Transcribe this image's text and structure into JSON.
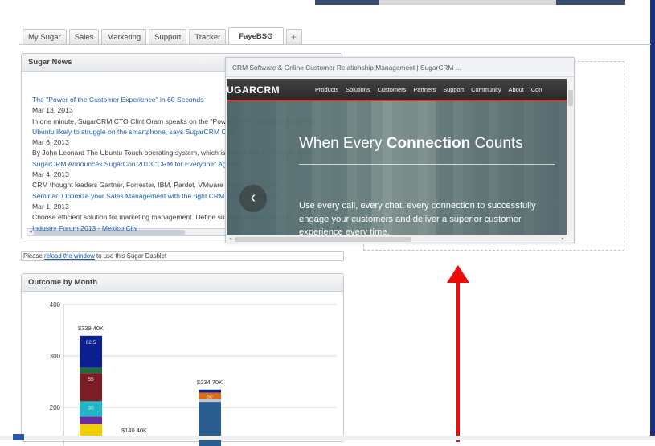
{
  "tabs": [
    {
      "label": "My Sugar",
      "active": false
    },
    {
      "label": "Sales",
      "active": false
    },
    {
      "label": "Marketing",
      "active": false
    },
    {
      "label": "Support",
      "active": false
    },
    {
      "label": "Tracker",
      "active": false
    },
    {
      "label": "FayeBSG",
      "active": true
    },
    {
      "label": "+",
      "active": false
    }
  ],
  "sugar_news": {
    "title": "Sugar News",
    "items": [
      {
        "text": "The \"Power of the Customer Experience\" in 60 Seconds",
        "kind": "link"
      },
      {
        "text": "Mar 13, 2013",
        "kind": "text"
      },
      {
        "text": "In one minute, SugarCRM CTO Clint Oram speaks on the \"Power of the Customer Experienc",
        "kind": "text"
      },
      {
        "text": "Ubuntu likely to struggle on the smartphone, says SugarCRM CEO",
        "kind": "link"
      },
      {
        "text": "Mar 6, 2013",
        "kind": "text"
      },
      {
        "text": "By John Leonard The Ubuntu Touch operating system, which is scheduled for October relea",
        "kind": "text"
      },
      {
        "text": "SugarCRM Announces SugarCon 2013 \"CRM for Everyone\" Agenda",
        "kind": "link"
      },
      {
        "text": "Mar 4, 2013",
        "kind": "text"
      },
      {
        "text": "CRM thought leaders Gartner, Forrester, IBM, Pardot, VMware and/or Paul Gree",
        "kind": "text"
      },
      {
        "text": "Seminar: Optimize your Sales Management with the right CRM solution - Kiev, U",
        "kind": "link"
      },
      {
        "text": "Mar 1, 2013",
        "kind": "text"
      },
      {
        "text": "Choose efficient solution for marketing management. Define suitable platform for your",
        "kind": "text"
      },
      {
        "text": "Industry Forum 2013 - Mexico City",
        "kind": "link"
      }
    ]
  },
  "reload_notice": {
    "prefix": "Please ",
    "link": "reload the window",
    "suffix": " to use this Sugar Dashlet"
  },
  "outcome": {
    "title": "Outcome by Month"
  },
  "chart_data": {
    "type": "bar",
    "stacked": true,
    "title": "Outcome by Month",
    "yticks": [
      200,
      300,
      400
    ],
    "ylim": [
      200,
      400
    ],
    "grid": true,
    "bars": [
      {
        "total_label": "$339.40K",
        "total": 339.4,
        "segments": [
          {
            "value": 62.5,
            "label": "62.5",
            "color": "#0b1f8f"
          },
          {
            "value": 10,
            "label": "",
            "color": "#1b6e3a"
          },
          {
            "value": 55,
            "label": "55",
            "color": "#7a1d24"
          },
          {
            "value": 30,
            "label": "30",
            "color": "#21b6c6"
          },
          {
            "value": 15,
            "label": "",
            "color": "#6a2aa0"
          },
          {
            "value": 25,
            "label": "",
            "color": "#f0d000"
          }
        ]
      },
      {
        "total_label": "$140.40K",
        "total": 140.4,
        "segments": []
      },
      {
        "total_label": "$234.70K",
        "total": 234.7,
        "segments": [
          {
            "value": 6,
            "label": "",
            "color": "#0b1f8f"
          },
          {
            "value": 12,
            "label": "50",
            "color": "#e06a10"
          },
          {
            "value": 6,
            "label": "",
            "color": "#c0c7d0"
          },
          {
            "value": 210.7,
            "label": "",
            "color": "#2a5d8f"
          }
        ]
      }
    ]
  },
  "popup": {
    "title": "CRM Software & Online Customer Relationship Management | SugarCRM ...",
    "logo": "UGARCRM",
    "nav": [
      "Products",
      "Solutions",
      "Customers",
      "Partners",
      "Support",
      "Community",
      "About",
      "Con"
    ],
    "heading_pre": "When Every ",
    "heading_bold": "Connection",
    "heading_post": " Counts",
    "body": "Use every call, every chat, every connection to successfully engage your customers and deliver a superior customer experience every time.",
    "prev": "‹"
  },
  "colors": {
    "link": "#1a60b5",
    "accent_red": "#ee0a0a",
    "nav_bg": "#2a2a2a"
  }
}
